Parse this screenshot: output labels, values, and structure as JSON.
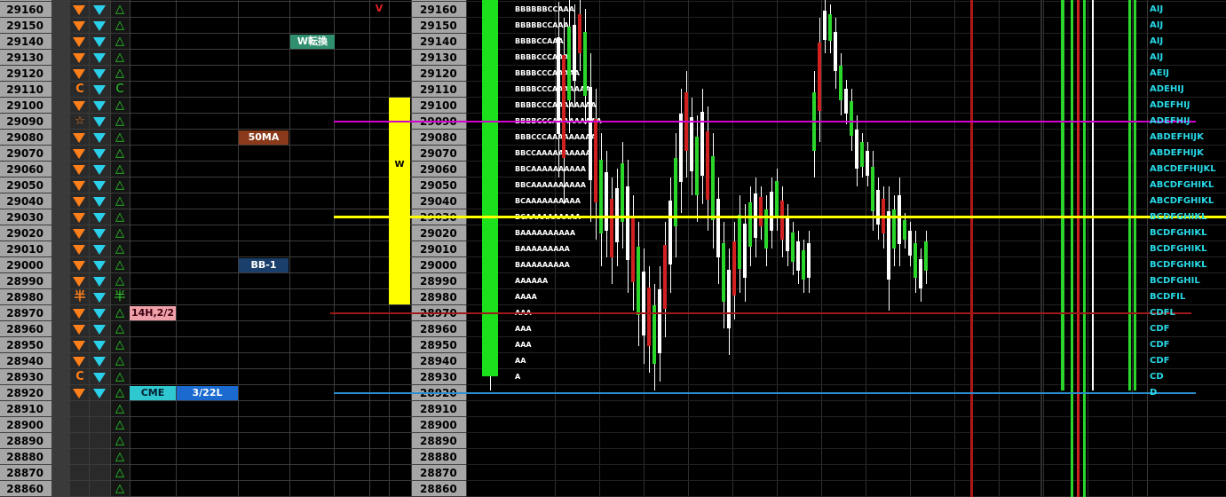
{
  "prices": [
    29160,
    29150,
    29140,
    29130,
    29120,
    29110,
    29100,
    29090,
    29080,
    29070,
    29060,
    29050,
    29040,
    29030,
    29020,
    29010,
    29000,
    28990,
    28980,
    28970,
    28960,
    28950,
    28940,
    28930,
    28920,
    28910,
    28900,
    28890,
    28880,
    28870,
    28860
  ],
  "signal_column": {
    "29110": "C",
    "29090": "☆",
    "28980": "半",
    "28930": "C"
  },
  "tags": {
    "w_tenkan": "W転換",
    "ma50": "50MA",
    "bb_minus1": "BB-1",
    "h14": "14H,2/2",
    "cme": "CME",
    "date_level": "3/22L",
    "v_mark": "V",
    "w_mark": "W"
  },
  "tpo_profile": [
    "BBBBBBCCAAA",
    "BBBBBCCAAA",
    "BBBBCCAAA",
    "BBBBCCCAAA",
    "BBBBCCCAAAAA",
    "BBBBCCCAAAAAAA",
    "BBBBCCCAAAAAAAA",
    "BBBBCCCAAAAAAAAA",
    "BBBCCCAAAAAAAAA",
    "BBCCAAAAAAAAAA",
    "BBCAAAAAAAAAA",
    "BBCAAAAAAAAAA",
    "BCAAAAAAAAAA",
    "BCAAAAAAAAAA",
    "BAAAAAAAAAA",
    "BAAAAAAAAA",
    "BAAAAAAAAA",
    "AAAAAA",
    "AAAA",
    "AAA",
    "AAA",
    "AAA",
    "AA",
    "A",
    "",
    "",
    "",
    "",
    "",
    "",
    ""
  ],
  "right_profile": [
    "AIJ",
    "AIJ",
    "AIJ",
    "AIJ",
    "AEIJ",
    "ADEHIJ",
    "ADEFHIJ",
    "ADEFHIJ",
    "ABDEFHIJK",
    "ABDEFHIJK",
    "ABCDEFHIJKL",
    "ABCDFGHIKL",
    "ABCDFGHIKL",
    "BCDFGHIKL",
    "BCDFGHIKL",
    "BCDFGHIKL",
    "BCDFGHIKL",
    "BCDFGHIL",
    "BCDFIL",
    "CDFL",
    "CDF",
    "CDF",
    "CDF",
    "CD",
    "D",
    "",
    "",
    "",
    "",
    "",
    ""
  ],
  "colors": {
    "price_bg": "#a6a6a6",
    "arrow_orange": "#ff7f1a",
    "arrow_cyan": "#2ad0ea",
    "triangle_green": "#2bd62b",
    "yellow": "#ffff00",
    "green_bar": "#1de01d",
    "magenta_line": "#d000d0",
    "red_line": "#a01818",
    "blue_line": "#2a8fd0"
  },
  "icons": {
    "down": "down-triangle-icon",
    "up": "up-triangle-outline-icon"
  }
}
